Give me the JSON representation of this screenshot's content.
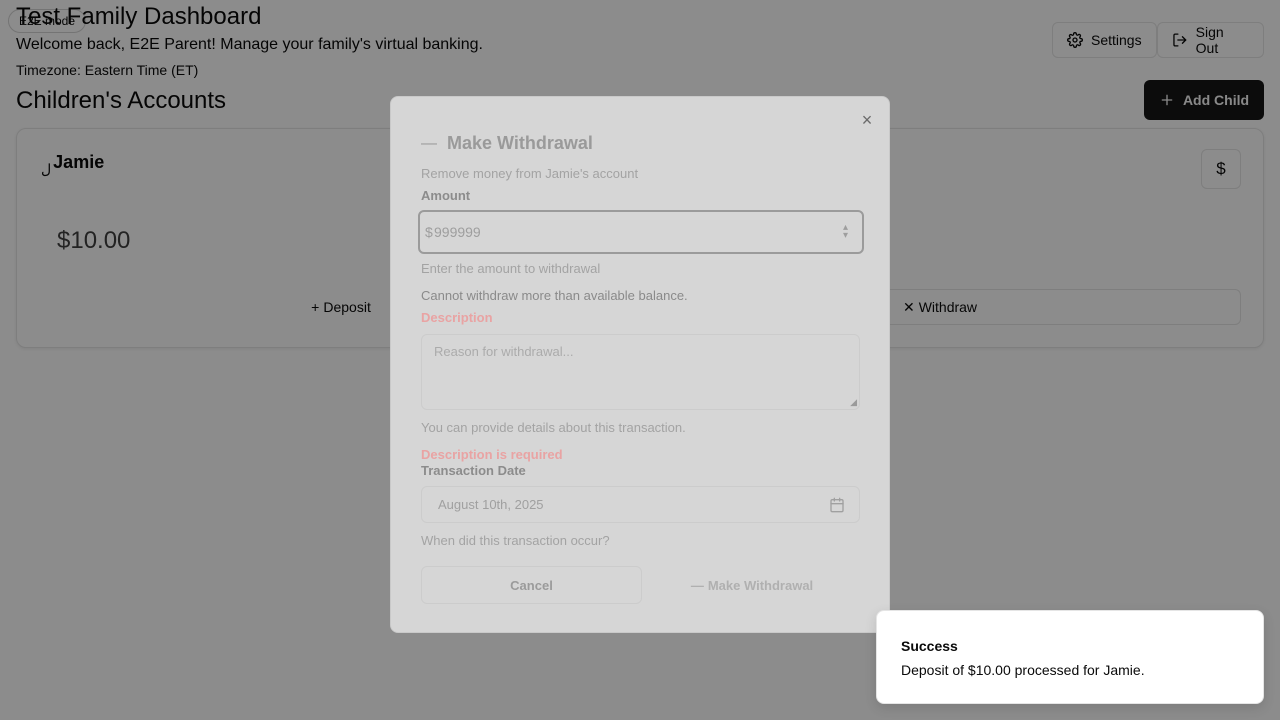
{
  "mode_badge": "E2E mode",
  "header": {
    "title": "Test Family Dashboard",
    "welcome": "Welcome back, E2E Parent! Manage your family's virtual banking.",
    "timezone": "Timezone: Eastern Time (ET)",
    "settings_label": "Settings",
    "signout_label": "Sign Out"
  },
  "children_section": {
    "title": "Children's Accounts",
    "add_label": "Add Child"
  },
  "child_card": {
    "name": "Jamie",
    "name_glyph": "ل",
    "balance": "$10.00",
    "dollar_icon": "$",
    "deposit_label": "Deposit",
    "withdraw_label": "Withdraw"
  },
  "modal": {
    "title": "Make Withdrawal",
    "subtitle": "Remove money from Jamie's account",
    "amount_label": "Amount",
    "amount_prefix": "$",
    "amount_value": "999999",
    "amount_hint": "Enter the amount to withdrawal",
    "amount_error": "Cannot withdraw more than available balance.",
    "description_label": "Description",
    "description_placeholder": "Reason for withdrawal...",
    "description_hint": "You can provide details about this transaction.",
    "description_error": "Description is required",
    "date_label": "Transaction Date",
    "date_value": "August 10th, 2025",
    "date_hint": "When did this transaction occur?",
    "cancel_label": "Cancel",
    "submit_label": "Make Withdrawal"
  },
  "toast": {
    "title": "Success",
    "message": "Deposit of $10.00 processed for Jamie."
  },
  "colors": {
    "primary": "#171717",
    "error": "#e9a3a3",
    "overlay": "rgba(0,0,0,0.45)"
  }
}
